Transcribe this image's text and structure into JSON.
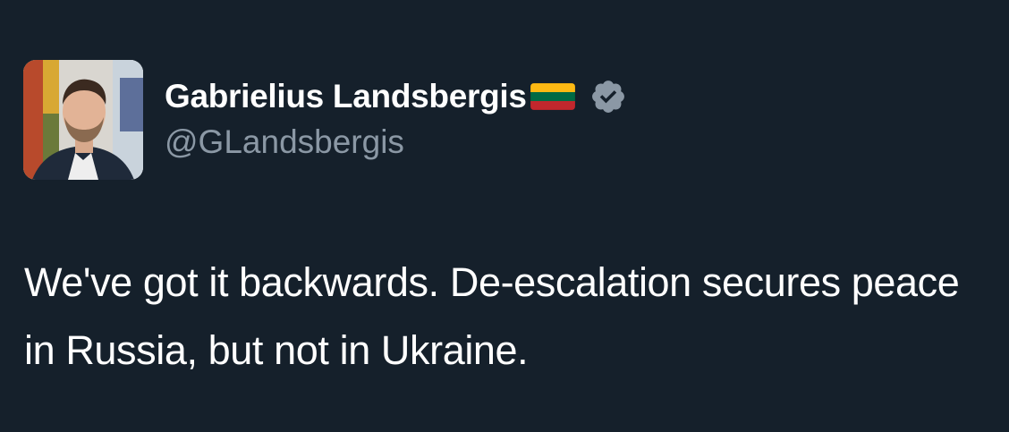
{
  "author": {
    "display_name": "Gabrielius Landsbergis",
    "handle": "@GLandsbergis",
    "flag": "flag-lithuania-icon",
    "verified": true,
    "verified_badge_color": "#8b98a5"
  },
  "tweet": {
    "text": "We've got it backwards. De-escalation secures peace in Russia, but not in Ukraine."
  },
  "colors": {
    "background": "#15202b",
    "text_primary": "#ffffff",
    "text_secondary": "#8b98a5"
  }
}
